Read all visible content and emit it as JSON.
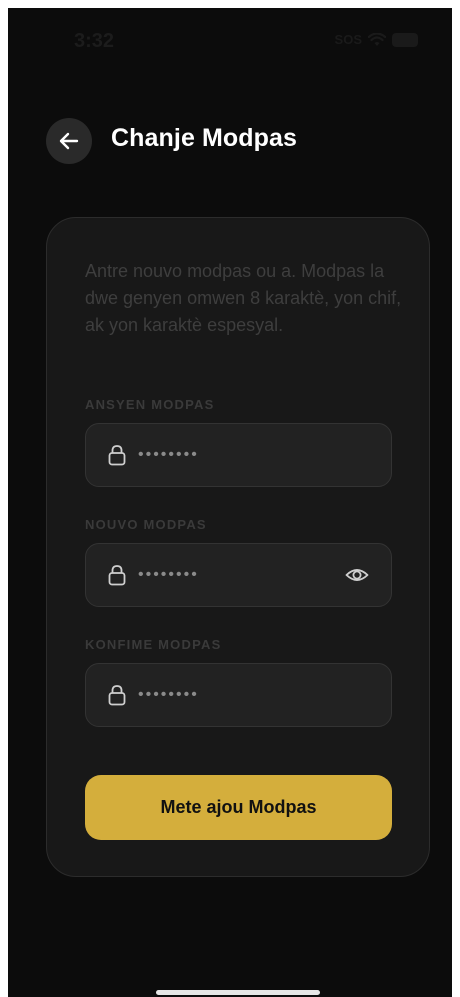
{
  "status_bar": {
    "time": "3:32",
    "carrier": "SOS"
  },
  "header": {
    "title": "Chanje Modpas",
    "back_icon": "arrow-left-icon"
  },
  "form": {
    "instructions": "Antre nouvo modpas ou a. Modpas la dwe genyen omwen 8 karaktè, yon chif, ak yon karaktè espesyal.",
    "fields": [
      {
        "label": "ANSYEN MODPAS",
        "value": "••••••••",
        "icon": "lock-icon"
      },
      {
        "label": "NOUVO MODPAS",
        "value": "••••••••",
        "icon": "lock-icon",
        "toggle_icon": "eye-icon"
      },
      {
        "label": "KONFIME MODPAS",
        "value": "••••••••",
        "icon": "lock-icon"
      }
    ],
    "submit_label": "Mete ajou Modpas"
  },
  "colors": {
    "background": "#0c0c0c",
    "card": "#181818",
    "field": "#222222",
    "accent": "#d4ae3c"
  }
}
